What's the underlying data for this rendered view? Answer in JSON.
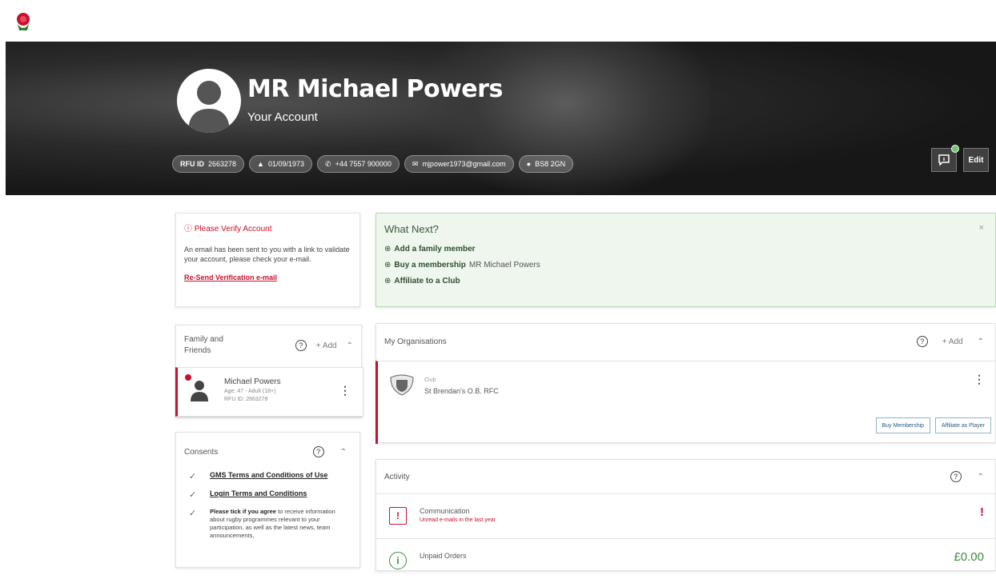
{
  "app": {
    "logo": "rose-logo-icon"
  },
  "profile": {
    "name": "MR Michael Powers",
    "subtitle": "Your Account",
    "chips": [
      {
        "icon": "",
        "label": "RFU ID",
        "value": "2663278"
      },
      {
        "icon": "cake-icon",
        "label": "",
        "value": "01/09/1973"
      },
      {
        "icon": "phone-icon",
        "label": "",
        "value": "+44 7557 900000"
      },
      {
        "icon": "mail-icon",
        "label": "",
        "value": "mjpower1973@gmail.com"
      },
      {
        "icon": "pin-icon",
        "label": "",
        "value": "BS8 2GN"
      }
    ],
    "edit_label": "Edit"
  },
  "verify": {
    "title": "Please Verify Account",
    "body": "An email has been sent to you with a link to validate your account, please check your e-mail.",
    "link": "Re-Send Verification e-mail"
  },
  "whatnext": {
    "title": "What Next?",
    "close": "×",
    "items": [
      {
        "bold": "Add a family member",
        "suffix": ""
      },
      {
        "bold": "Buy a membership",
        "suffix": "MR Michael Powers"
      },
      {
        "bold": "Affiliate to a Club",
        "suffix": ""
      }
    ]
  },
  "family": {
    "title": "Family and Friends",
    "add_label": "+ Add",
    "member": {
      "name": "Michael Powers",
      "age": "Age: 47 - Adult (18+)",
      "rfu": "RFU ID: 2663278"
    }
  },
  "organisations": {
    "title": "My Organisations",
    "add_label": "+ Add",
    "org": {
      "type": "Club",
      "name": "St Brendan's O.B. RFC",
      "buttons": [
        "Buy Membership",
        "Affiliate as Player"
      ]
    }
  },
  "consents": {
    "title": "Consents",
    "items": [
      "GMS Terms and Conditions of Use",
      "Login Terms and Conditions"
    ],
    "para_bold": "Please tick if you agree",
    "para_rest": "to receive information about rugby programmes relevant to your participation, as well as the latest news, team announcements,"
  },
  "activity": {
    "title": "Activity",
    "rows": [
      {
        "name": "Communication",
        "sub": "Unread e-mails in the last year",
        "value": "!"
      },
      {
        "name": "Unpaid Orders",
        "sub": "",
        "value": "£0.00"
      }
    ]
  },
  "colors": {
    "accent": "#c8102e",
    "success": "#3c8c3c",
    "panel_green": "#eef6ee"
  }
}
